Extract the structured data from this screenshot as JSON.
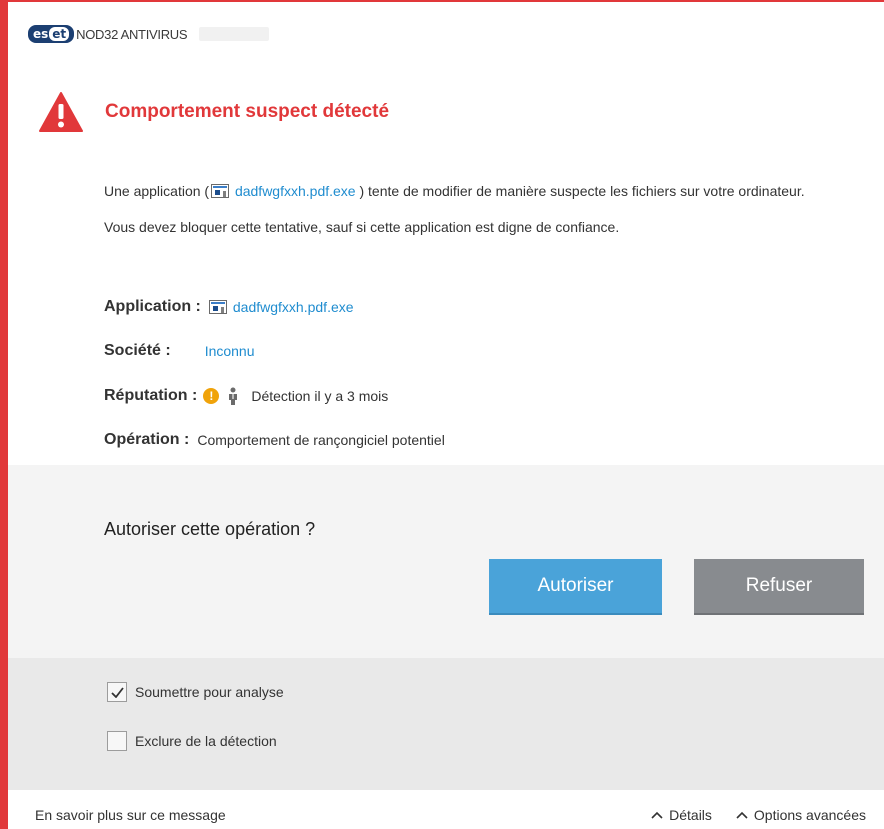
{
  "window": {
    "brand_logo": "eset",
    "product_name": "NOD32 ANTIVIRUS",
    "accent_color": "#e1383a"
  },
  "alert": {
    "title": "Comportement suspect détecté",
    "icon": "warning-triangle-icon"
  },
  "message": {
    "line_prefix": "Une application (",
    "app_link": "dadfwgfxxh.pdf.exe",
    "line_suffix": ") tente de modifier de manière suspecte les fichiers sur votre ordinateur.",
    "advice": "Vous devez bloquer cette tentative, sauf si cette application est digne de confiance."
  },
  "details": {
    "application_label": "Application :",
    "application_value": "dadfwgfxxh.pdf.exe",
    "company_label": "Société :",
    "company_value": "Inconnu",
    "reputation_label": "Réputation :",
    "reputation_value": "Détection il y a 3 mois",
    "operation_label": "Opération :",
    "operation_value": "Comportement de rançongiciel potentiel"
  },
  "prompt": {
    "question": "Autoriser cette opération ?",
    "allow_label": "Autoriser",
    "deny_label": "Refuser",
    "allow_color": "#4aa3d9",
    "deny_color": "#888b8f"
  },
  "options": {
    "submit_label": "Soumettre pour analyse",
    "submit_checked": true,
    "exclude_label": "Exclure de la détection",
    "exclude_checked": false
  },
  "footer": {
    "learn_more": "En savoir plus sur ce message",
    "details_label": "Détails",
    "advanced_label": "Options avancées"
  }
}
